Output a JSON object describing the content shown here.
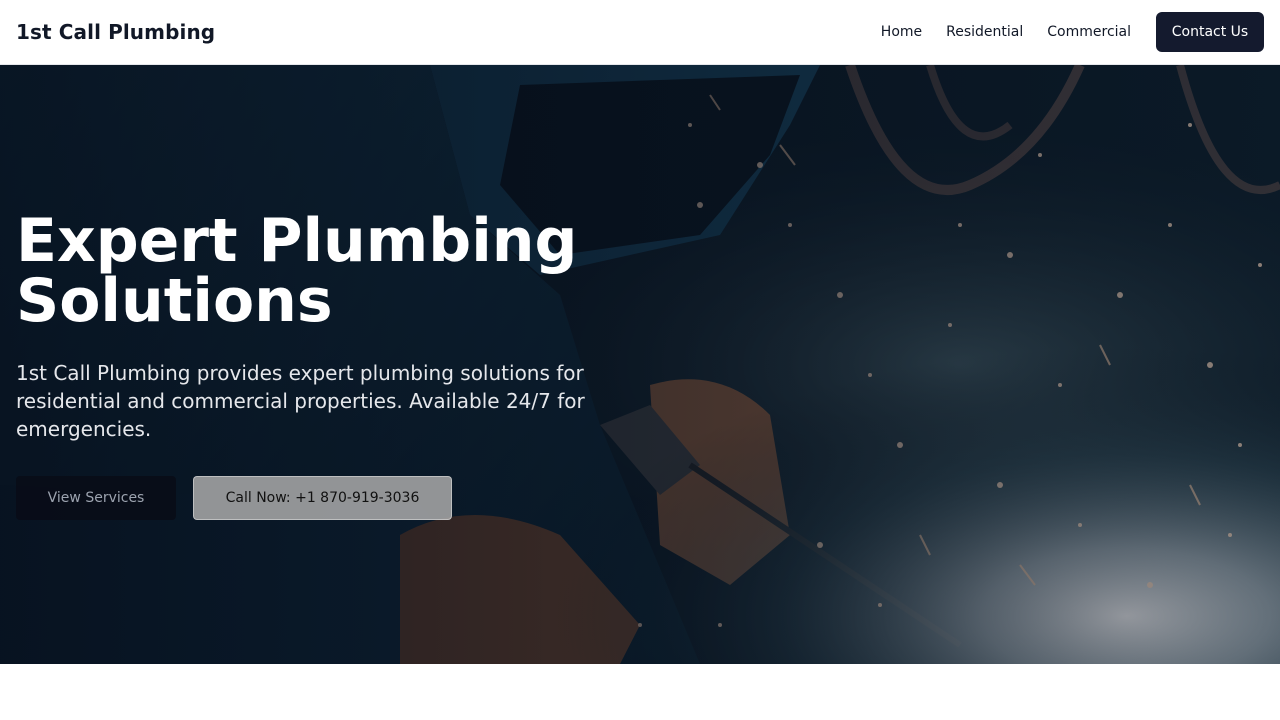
{
  "header": {
    "brand": "1st Call Plumbing",
    "nav": [
      "Home",
      "Residential",
      "Commercial"
    ],
    "contact_label": "Contact Us"
  },
  "hero": {
    "title_line1": "Expert Plumbing",
    "title_line2": "Solutions",
    "description": "1st Call Plumbing provides expert plumbing solutions for residential and commercial properties. Available 24/7 for emergencies.",
    "services_label": "View Services",
    "call_label": "Call Now: +1 870-919-3036",
    "background_image": "welder-sparks-photo"
  },
  "colors": {
    "brand_dark": "#141a2e",
    "header_bg": "#ffffff",
    "hero_text": "#ffffff"
  }
}
